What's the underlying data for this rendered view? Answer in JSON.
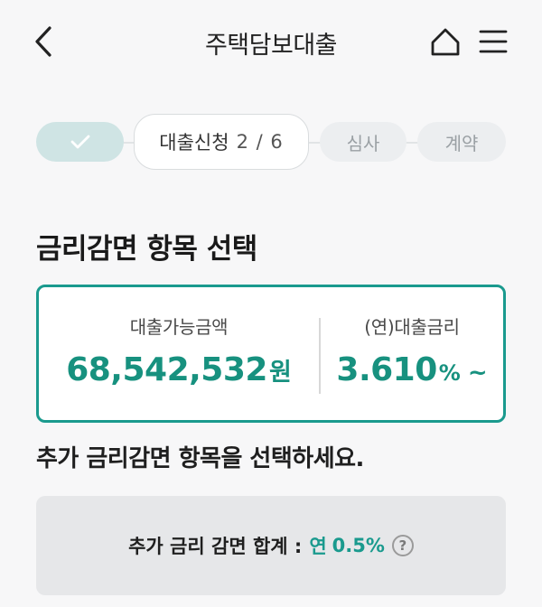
{
  "header": {
    "title": "주택담보대출",
    "back_icon": "chevron-left-icon",
    "home_icon": "home-icon",
    "menu_icon": "hamburger-menu-icon"
  },
  "stepper": {
    "done_icon": "check-icon",
    "current_label": "대출신청",
    "current_count": "2 / 6",
    "step_review": "심사",
    "step_contract": "계약"
  },
  "section": {
    "title": "금리감면 항목 선택"
  },
  "summary": {
    "amount_label": "대출가능금액",
    "amount_value": "68,542,532",
    "amount_unit": "원",
    "rate_label": "(연)대출금리",
    "rate_value": "3.610",
    "rate_unit": "%",
    "rate_suffix": "~"
  },
  "instruction": "추가 금리감면 항목을 선택하세요.",
  "total": {
    "label": "추가 금리 감면 합계 :",
    "year": "연",
    "rate": "0.5%",
    "help_glyph": "?"
  },
  "colors": {
    "accent": "#1a9a8e",
    "done_step": "#cfe4e4",
    "background": "#f7f7f8"
  }
}
